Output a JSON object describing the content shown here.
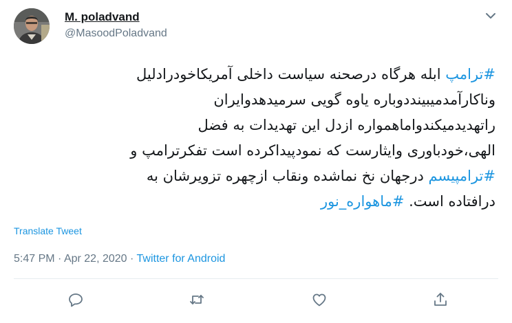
{
  "user": {
    "display_name": "M. poladvand",
    "handle": "@MasoodPoladvand"
  },
  "tweet": {
    "lines": [
      [
        {
          "t": "#ترامپ",
          "tag": true
        },
        {
          "t": " ابله هرگاه درصحنه سیاست داخلی آمریکاخودرادلیل",
          "tag": false
        }
      ],
      [
        {
          "t": "وناکارآمدمیبینددوباره یاوه گویی سرمیدهدوایران",
          "tag": false
        }
      ],
      [
        {
          "t": "راتهدیدمیکندواماهمواره ازدل این تهدیدات به فضل",
          "tag": false
        }
      ],
      [
        {
          "t": "الهی،خودباوری وایثارست که نمودپیداکرده است تفکرترامپ و",
          "tag": false
        }
      ],
      [
        {
          "t": "#ترامپیسم",
          "tag": true
        },
        {
          "t": " درجهان نخ نماشده ونقاب ازچهره تزویرشان به",
          "tag": false
        }
      ],
      [
        {
          "t": "درافتاده است.  ",
          "tag": false
        },
        {
          "t": "#ماهواره_نور",
          "tag": true
        }
      ]
    ],
    "translate_label": "Translate Tweet",
    "time": "5:47 PM",
    "separator": " · ",
    "date": "Apr 22, 2020",
    "source": "Twitter for Android"
  },
  "icons": {
    "menu": "chevron-down-icon",
    "reply": "reply-icon",
    "retweet": "retweet-icon",
    "like": "like-icon",
    "share": "share-icon"
  },
  "colors": {
    "link": "#1b95e0",
    "muted": "#657786",
    "icon": "#657786",
    "text": "#14171a"
  }
}
